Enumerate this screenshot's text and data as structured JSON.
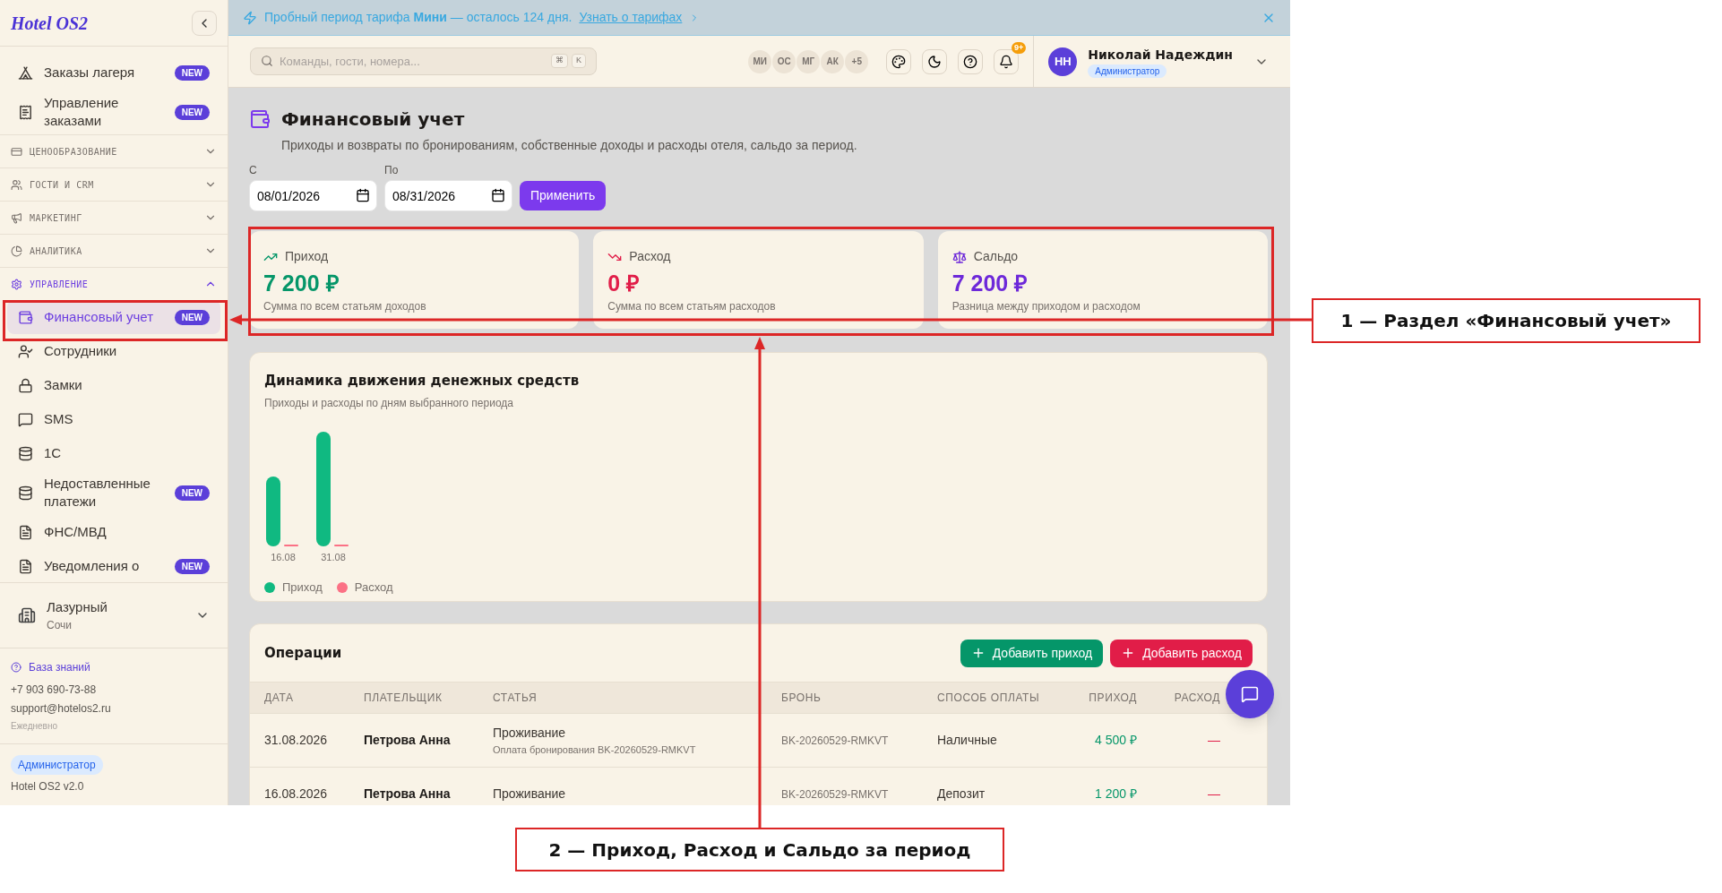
{
  "sidebar": {
    "logo": "Hotel OS2",
    "nav": [
      {
        "kind": "item",
        "label": "Заказы лагеря",
        "badge": "NEW",
        "selected": false
      },
      {
        "kind": "item",
        "label": "Управление заказами",
        "badge": "NEW",
        "selected": false
      },
      {
        "kind": "section",
        "label": "ЦЕНООБРАЗОВАНИЕ",
        "expanded": false
      },
      {
        "kind": "section",
        "label": "ГОСТИ И CRM",
        "expanded": false
      },
      {
        "kind": "section",
        "label": "МАРКЕТИНГ",
        "expanded": false
      },
      {
        "kind": "section",
        "label": "АНАЛИТИКА",
        "expanded": false
      },
      {
        "kind": "section",
        "label": "УПРАВЛЕНИЕ",
        "expanded": true,
        "children": [
          {
            "label": "Финансовый учет",
            "badge": "NEW",
            "selected": true
          },
          {
            "label": "Сотрудники",
            "selected": false
          },
          {
            "label": "Замки",
            "selected": false
          },
          {
            "label": "SMS",
            "selected": false
          },
          {
            "label": "1С",
            "selected": false
          },
          {
            "label": "Недоставленные платежи",
            "badge": "NEW",
            "selected": false
          },
          {
            "label": "ФНС/МВД",
            "selected": false
          },
          {
            "label": "Уведомления о",
            "badge": "NEW",
            "selected": false
          }
        ]
      }
    ],
    "hotel": {
      "name": "Лазурный",
      "city": "Сочи"
    },
    "help": {
      "link": "База знаний",
      "phone": "+7 903 690-73-88",
      "email": "support@hotelos2.ru",
      "hours": "Ежедневно"
    },
    "role": "Администратор",
    "version": "Hotel OS2 v2.0"
  },
  "banner": {
    "text": "Пробный период тарифа **Мини** — осталось 124 дня.",
    "link": "Узнать о тарифах"
  },
  "topbar": {
    "search": {
      "placeholder": "Команды, гости, номера...",
      "keys": [
        "⌘",
        "K"
      ]
    },
    "avatars": [
      "МИ",
      "ОС",
      "МГ",
      "АК",
      "+5"
    ],
    "notifications": "9+",
    "user": {
      "initials": "НН",
      "name": "Николай Надеждин",
      "role": "Администратор"
    }
  },
  "page": {
    "title": "Финансовый учет",
    "subtitle": "Приходы и возвраты по бронированиям, собственные доходы и расходы отеля, сальдо за период.",
    "from": {
      "label": "С",
      "value": "08/01/2026"
    },
    "to": {
      "label": "По",
      "value": "08/31/2026"
    },
    "apply": "Применить"
  },
  "summary": [
    {
      "kind": "income",
      "label": "Приход",
      "value": "7 200 ₽",
      "note": "Сумма по всем статьям доходов"
    },
    {
      "kind": "expense",
      "label": "Расход",
      "value": "0 ₽",
      "note": "Сумма по всем статьям расходов"
    },
    {
      "kind": "balance",
      "label": "Сальдо",
      "value": "7 200 ₽",
      "note": "Разница между приходом и расходом"
    }
  ],
  "chart": {
    "title": "Динамика движения денежных средств",
    "subtitle": "Приходы и расходы по дням выбранного периода",
    "days": [
      "16.08",
      "31.08"
    ],
    "legend": [
      {
        "label": "Приход",
        "color": "#10b981"
      },
      {
        "label": "Расход",
        "color": "#fb7185"
      }
    ]
  },
  "operations": {
    "title": "Операции",
    "add_income": "Добавить приход",
    "add_expense": "Добавить расход",
    "columns": [
      "ДАТА",
      "ПЛАТЕЛЬЩИК",
      "СТАТЬЯ",
      "БРОНЬ",
      "СПОСОБ ОПЛАТЫ",
      "ПРИХОД",
      "РАСХОД"
    ],
    "rows": [
      {
        "date": "31.08.2026",
        "payer": "Петрова Анна",
        "article": "Проживание",
        "article_note": "Оплата бронирования BK-20260529-RMKVT",
        "booking": "BK-20260529-RMKVT",
        "method": "Наличные",
        "income": "4 500 ₽",
        "expense": "—"
      },
      {
        "date": "16.08.2026",
        "payer": "Петрова Анна",
        "article": "Проживание",
        "booking": "BK-20260529-RMKVT",
        "method": "Депозит",
        "income": "1 200 ₽",
        "expense": "—"
      }
    ]
  },
  "annotations": [
    {
      "label": "1 — Раздел «Финансовый учет»"
    },
    {
      "label": "2 — Приход, Расход и Сальдо за период"
    }
  ]
}
